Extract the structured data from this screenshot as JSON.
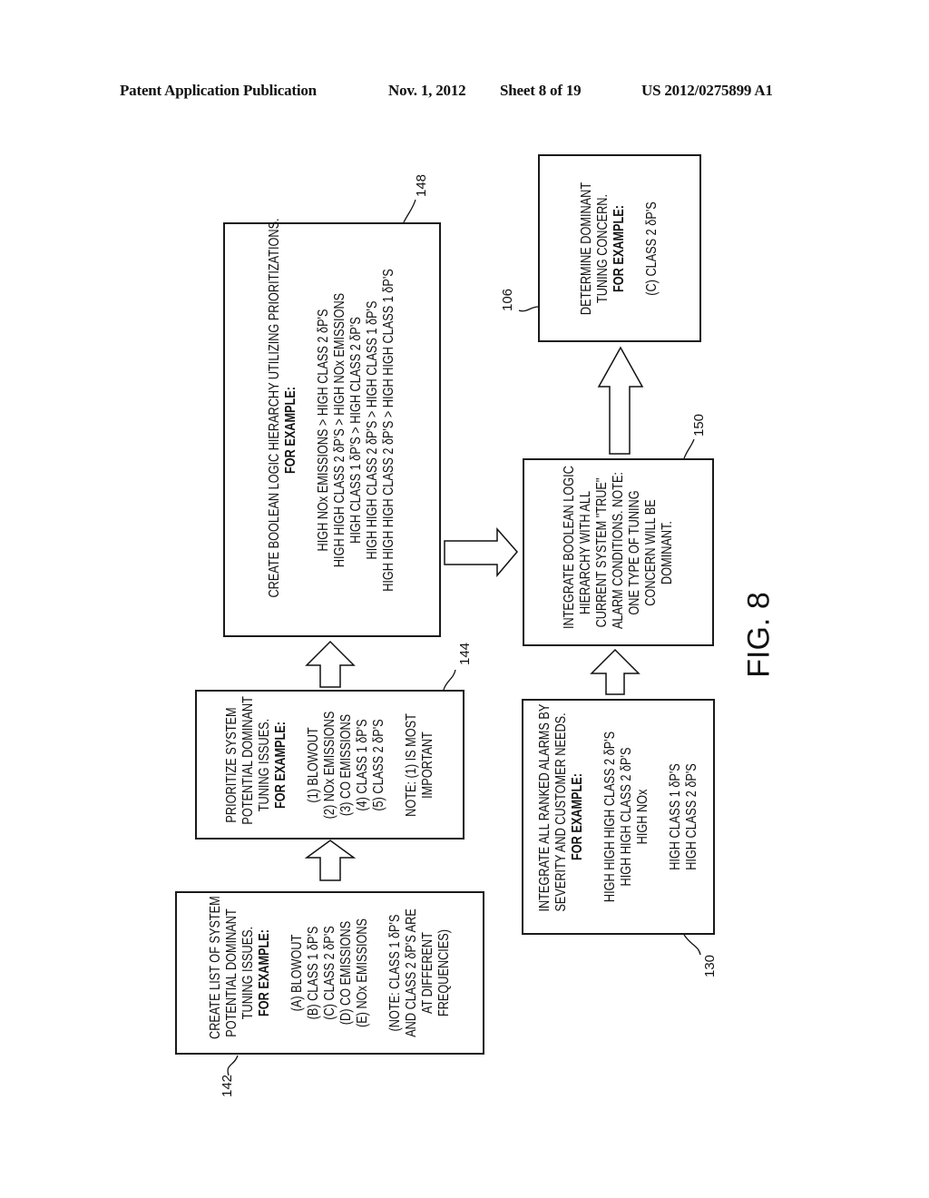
{
  "header": {
    "publication": "Patent Application Publication",
    "date": "Nov. 1, 2012",
    "sheet": "Sheet 8 of 19",
    "patent_number": "US 2012/0275899 A1"
  },
  "figure_label": "FIG. 8",
  "boxes": {
    "b142": {
      "ref": "142",
      "title": [
        "CREATE LIST OF SYSTEM",
        "POTENTIAL DOMINANT",
        "TUNING ISSUES."
      ],
      "example_label": "FOR EXAMPLE:",
      "items": [
        "(A) BLOWOUT",
        "(B) CLASS 1 δP'S",
        "(C) CLASS 2 δP'S",
        "(D) CO EMISSIONS",
        "(E) NOx EMISSIONS"
      ],
      "note": [
        "(NOTE: CLASS 1 δP'S",
        "AND CLASS 2 δP'S ARE",
        "AT DIFFERENT",
        "FREQUENCIES)"
      ]
    },
    "b144": {
      "ref": "144",
      "title": [
        "PRIORITIZE SYSTEM",
        "POTENTIAL DOMINANT",
        "TUNING ISSUES."
      ],
      "example_label": "FOR EXAMPLE:",
      "items": [
        "(1) BLOWOUT",
        "(2) NOx EMISSIONS",
        "(3) CO EMISSIONS",
        "(4) CLASS 1 δP'S",
        "(5) CLASS 2 δP'S"
      ],
      "note": [
        "NOTE: (1) IS MOST",
        "IMPORTANT"
      ]
    },
    "b148": {
      "ref": "148",
      "title": [
        "CREATE BOOLEAN LOGIC HIERARCHY UTILIZING PRIORITIZATIONS."
      ],
      "example_label": "FOR EXAMPLE:",
      "items": [
        "HIGH NOx EMISSIONS > HIGH CLASS 2 δP'S",
        "HIGH HIGH CLASS 2 δP'S > HIGH NOx EMISSIONS",
        "HIGH CLASS 1 δP'S > HIGH CLASS 2 δP'S",
        "HIGH HIGH CLASS 2 δP'S > HIGH CLASS 1 δP'S",
        "HIGH HIGH HIGH CLASS 2 δP'S > HIGH HIGH CLASS 1 δP'S"
      ]
    },
    "b130": {
      "ref": "130",
      "title": [
        "INTEGRATE ALL RANKED ALARMS BY",
        "SEVERITY AND CUSTOMER NEEDS."
      ],
      "example_label": "FOR EXAMPLE:",
      "items": [
        "HIGH HIGH HIGH CLASS 2 δP'S",
        "HIGH HIGH CLASS 2 δP'S",
        "HIGH NOx",
        "",
        "HIGH CLASS 1 δP'S",
        "HIGH CLASS 2 δP'S"
      ]
    },
    "b150": {
      "ref": "150",
      "lines": [
        "INTEGRATE BOOLEAN LOGIC",
        "HIERARCHY WITH ALL",
        "CURRENT SYSTEM \"TRUE\"",
        "ALARM CONDITIONS. NOTE:",
        "ONE TYPE OF TUNING",
        "CONCERN WILL BE",
        "DOMINANT."
      ]
    },
    "b106": {
      "ref": "106",
      "title": [
        "DETERMINE DOMINANT",
        "TUNING CONCERN."
      ],
      "example_label": "FOR EXAMPLE:",
      "items": [
        "(C) CLASS 2 δP'S"
      ]
    }
  }
}
